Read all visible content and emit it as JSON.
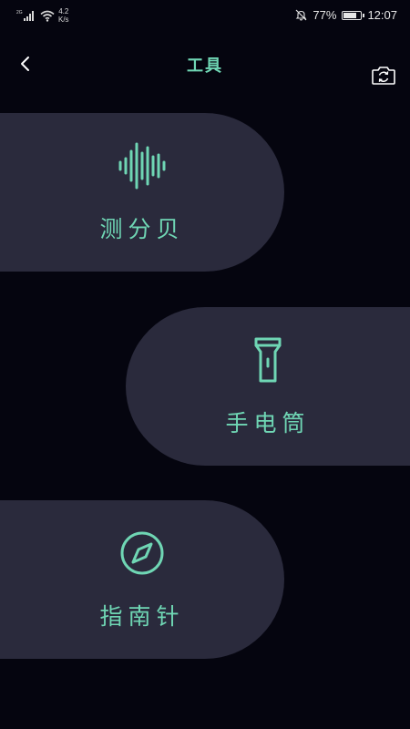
{
  "status_bar": {
    "network_type": "2G",
    "speed_value": "4.2",
    "speed_unit": "K/s",
    "battery": "77%",
    "battery_level": 0.77,
    "time": "12:07"
  },
  "header": {
    "title": "工具",
    "back_icon": "chevron-left-icon",
    "camera_icon": "camera-rotate-icon"
  },
  "tools": [
    {
      "label": "测分贝",
      "icon": "sound-wave-icon"
    },
    {
      "label": "手电筒",
      "icon": "flashlight-icon"
    },
    {
      "label": "指南针",
      "icon": "compass-icon"
    }
  ],
  "colors": {
    "background": "#05050f",
    "card": "#2a2a3c",
    "accent": "#6fd6b4"
  }
}
